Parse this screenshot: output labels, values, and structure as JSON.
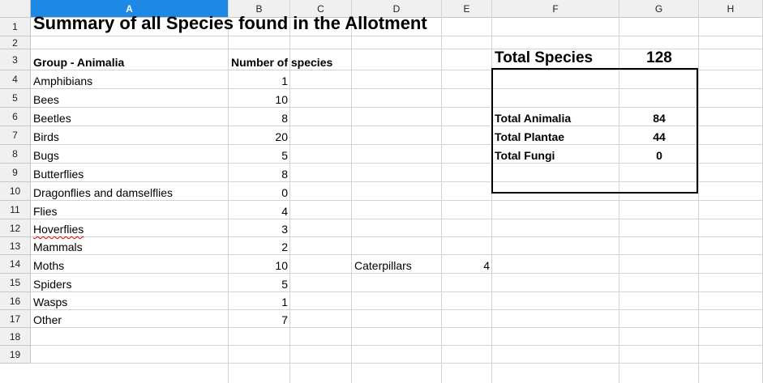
{
  "columns": [
    "A",
    "B",
    "C",
    "D",
    "E",
    "F",
    "G",
    "H"
  ],
  "rows": [
    "1",
    "2",
    "3",
    "4",
    "5",
    "6",
    "7",
    "8",
    "9",
    "10",
    "11",
    "12",
    "13",
    "14",
    "15",
    "16",
    "17",
    "18",
    "19"
  ],
  "title": "Summary of all Species found in the Allotment",
  "headers": {
    "group": "Group - Animalia",
    "number": "Number of species"
  },
  "groups": [
    {
      "name": "Amphibians",
      "count": "1"
    },
    {
      "name": "Bees",
      "count": "10"
    },
    {
      "name": "Beetles",
      "count": "8"
    },
    {
      "name": "Birds",
      "count": "20"
    },
    {
      "name": "Bugs",
      "count": "5"
    },
    {
      "name": "Butterflies",
      "count": "8"
    },
    {
      "name": "Dragonflies and damselflies",
      "count": "0"
    },
    {
      "name": "Flies",
      "count": "4"
    },
    {
      "name": "Hoverflies",
      "count": "3"
    },
    {
      "name": "Mammals",
      "count": "2"
    },
    {
      "name": "Moths",
      "count": "10"
    },
    {
      "name": "Spiders",
      "count": "5"
    },
    {
      "name": "Wasps",
      "count": "1"
    },
    {
      "name": "Other",
      "count": "7"
    }
  ],
  "extra": {
    "label": "Caterpillars",
    "value": "4"
  },
  "summary": {
    "total_species_label": "Total Species",
    "total_species_value": "128",
    "animalia_label": "Total Animalia",
    "animalia_value": "84",
    "plantae_label": "Total Plantae",
    "plantae_value": "44",
    "fungi_label": "Total Fungi",
    "fungi_value": "0"
  },
  "selected_column": "A",
  "colors": {
    "selected_header": "#1e88e5",
    "header_bg": "#f0f0f0",
    "gridline": "#d4d4d4",
    "spellcheck": "#e00000"
  }
}
